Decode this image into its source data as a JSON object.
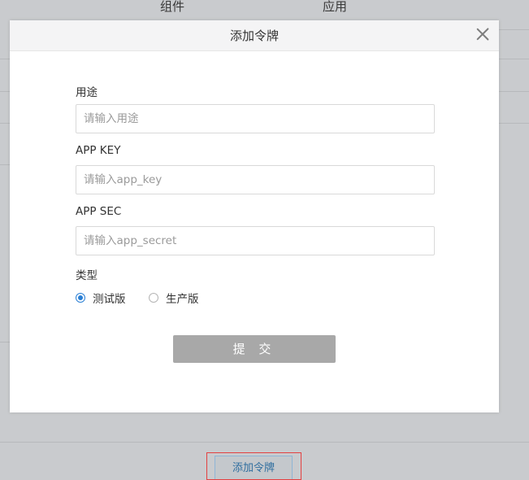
{
  "background": {
    "columns": [
      "组件",
      "应用"
    ],
    "add_token_button": "添加令牌",
    "highlight_color": "#e34141"
  },
  "modal": {
    "title": "添加令牌",
    "close_icon": "close-icon",
    "fields": [
      {
        "label": "用途",
        "placeholder": "请输入用途",
        "value": ""
      },
      {
        "label": "APP KEY",
        "placeholder": "请输入app_key",
        "value": ""
      },
      {
        "label": "APP SEC",
        "placeholder": "请输入app_secret",
        "value": ""
      }
    ],
    "type": {
      "label": "类型",
      "options": [
        {
          "label": "测试版",
          "checked": true
        },
        {
          "label": "生产版",
          "checked": false
        }
      ]
    },
    "submit_label": "提 交",
    "accent_color": "#2a7fd4",
    "submit_color": "#a8a8a8"
  }
}
